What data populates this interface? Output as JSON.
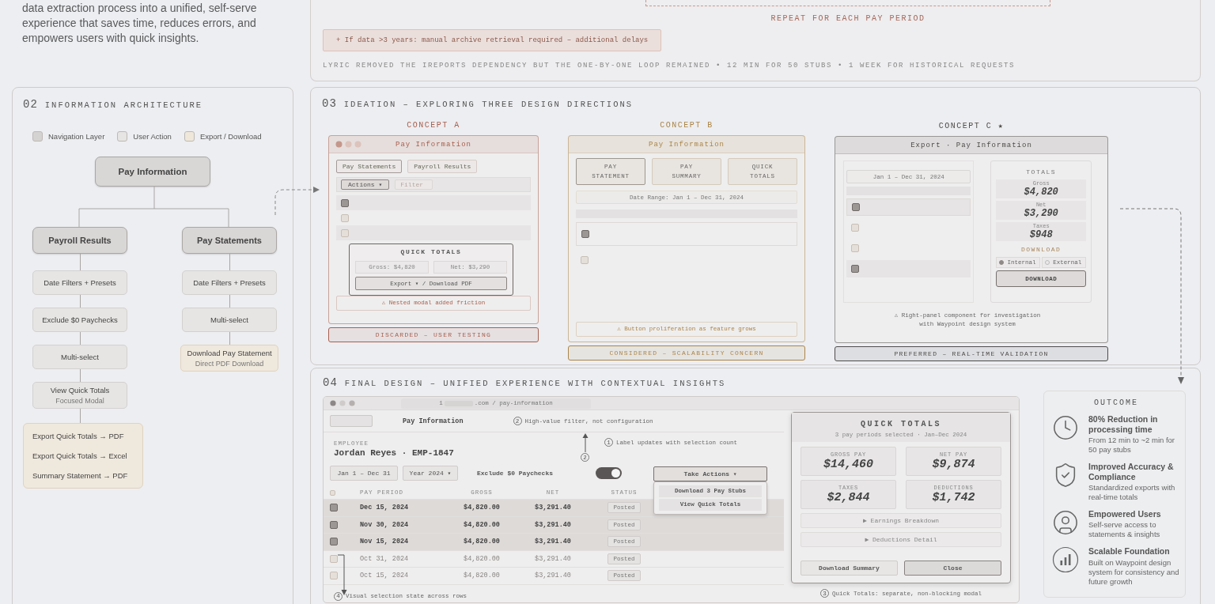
{
  "intro": "data extraction process into a unified, self-serve experience that saves time, reduces errors, and empowers users with quick insights.",
  "process": {
    "loop_label": "REPEAT FOR EACH PAY PERIOD",
    "note": "+ If data >3 years: manual archive retrieval required – additional delays",
    "summary": "LYRIC REMOVED THE IREPORTS DEPENDENCY BUT THE ONE-BY-ONE LOOP REMAINED • 12 MIN FOR 50 STUBS • 1 WEEK FOR HISTORICAL REQUESTS"
  },
  "architecture": {
    "number": "02",
    "title": "INFORMATION ARCHITECTURE",
    "legend": [
      {
        "label": "Navigation Layer",
        "color": "#d5d3d2"
      },
      {
        "label": "User Action",
        "color": "#e6e5e3"
      },
      {
        "label": "Export / Download",
        "color": "#efe7da"
      }
    ],
    "root": "Pay Information",
    "branches": [
      {
        "label": "Payroll Results",
        "steps": [
          {
            "kind": "action",
            "label": "Date Filters + Presets"
          },
          {
            "kind": "action",
            "label": "Exclude $0 Paychecks"
          },
          {
            "kind": "action",
            "label": "Multi-select"
          },
          {
            "kind": "action",
            "label": "View Quick Totals",
            "sublabel": "Focused Modal"
          },
          {
            "kind": "export_group",
            "items": [
              "Export Quick Totals → PDF",
              "Export Quick Totals → Excel",
              "Summary Statement → PDF"
            ]
          }
        ]
      },
      {
        "label": "Pay Statements",
        "steps": [
          {
            "kind": "action",
            "label": "Date Filters + Presets"
          },
          {
            "kind": "action",
            "label": "Multi-select"
          },
          {
            "kind": "export",
            "label": "Download Pay Statement",
            "sublabel": "Direct PDF Download"
          }
        ]
      }
    ]
  },
  "ideation": {
    "number": "03",
    "title": "IDEATION – EXPLORING THREE DESIGN DIRECTIONS",
    "concepts": [
      {
        "kind": "modal",
        "label": "CONCEPT A",
        "color": "#a8604f",
        "window_title": "Pay Information",
        "tabs": [
          {
            "label": "Pay Statements",
            "selected": true
          },
          {
            "label": "Payroll Results",
            "selected": false
          }
        ],
        "action_button": "Actions ▾",
        "filter_placeholder": "Filter",
        "rows": [
          {
            "checked": true
          },
          {
            "checked": false
          },
          {
            "checked": false
          }
        ],
        "modal": {
          "title": "QUICK TOTALS",
          "stats": [
            "Gross: $4,820",
            "Net: $3,290"
          ],
          "button": "Export ▾ / Download PDF"
        },
        "note": "⚠ Nested modal added friction",
        "status": "DISCARDED – USER TESTING"
      },
      {
        "kind": "buttons",
        "label": "CONCEPT B",
        "color": "#ab8549",
        "window_title": "Pay Information",
        "buttons": [
          {
            "label": "PAY STATEMENT",
            "selected": true
          },
          {
            "label": "PAY SUMMARY",
            "selected": false
          },
          {
            "label": "QUICK TOTALS",
            "selected": false
          }
        ],
        "date_range": "Date Range: Jan 1 – Dec 31, 2024",
        "rows": [
          {
            "checked": true
          },
          {
            "checked": false
          }
        ],
        "note": "⚠ Button proliferation as feature grows",
        "status": "CONSIDERED – SCALABILITY CONCERN"
      },
      {
        "kind": "panel",
        "label": "CONCEPT C ★",
        "color": "#4f4c4a",
        "window_title": "Export · Pay Information",
        "date_range": "Jan 1 – Dec 31, 2024",
        "rows": [
          {
            "checked": true
          },
          {
            "checked": false
          },
          {
            "checked": false
          },
          {
            "checked": true
          }
        ],
        "totals_title": "TOTALS",
        "totals": [
          {
            "label": "Gross",
            "value": "$4,820"
          },
          {
            "label": "Net",
            "value": "$3,290"
          },
          {
            "label": "Taxes",
            "value": "$948"
          }
        ],
        "download_title": "DOWNLOAD",
        "options": [
          {
            "label": "Internal",
            "selected": true
          },
          {
            "label": "External",
            "selected": false
          }
        ],
        "download_button": "DOWNLOAD",
        "note": "⚠ Right-panel component for investigation with Waypoint design system",
        "status": "PREFERRED – REAL-TIME VALIDATION"
      }
    ]
  },
  "final": {
    "number": "04",
    "title": "FINAL DESIGN – UNIFIED EXPERIENCE WITH CONTEXTUAL INSIGHTS",
    "url_start": "1",
    "url_end": ".com / pay-information",
    "app_title": "Pay Information",
    "filter_note": {
      "marker": "2",
      "text": "High-value filter, not configuration"
    },
    "label_note": {
      "marker": "1",
      "text": "Label updates with selection count"
    },
    "arrow_marker": "2",
    "employee_label": "EMPLOYEE",
    "employee": "Jordan Reyes · EMP-1847",
    "filters": [
      "Jan 1 – Dec 31",
      "Year 2024 ▾"
    ],
    "exclude_toggle": {
      "label": "Exclude $0 Paychecks",
      "on": true
    },
    "actions": {
      "label": "Take Actions ▾",
      "expanded": true,
      "items": [
        "Download 3 Pay Stubs",
        "View Quick Totals"
      ]
    },
    "table": {
      "select_all": {
        "checked": false
      },
      "columns": [
        "PAY PERIOD",
        "GROSS",
        "NET",
        "STATUS"
      ],
      "rows": [
        {
          "selected": true,
          "period": "Dec 15, 2024",
          "gross": "$4,820.00",
          "net": "$3,291.40",
          "status": "Posted"
        },
        {
          "selected": true,
          "period": "Nov 30, 2024",
          "gross": "$4,820.00",
          "net": "$3,291.40",
          "status": "Posted"
        },
        {
          "selected": true,
          "period": "Nov 15, 2024",
          "gross": "$4,820.00",
          "net": "$3,291.40",
          "status": "Posted"
        },
        {
          "selected": false,
          "period": "Oct 31, 2024",
          "gross": "$4,820.00",
          "net": "$3,291.40",
          "status": "Posted"
        },
        {
          "selected": false,
          "period": "Oct 15, 2024",
          "gross": "$4,820.00",
          "net": "$3,291.40",
          "status": "Posted"
        }
      ]
    },
    "rows_note": {
      "marker": "4",
      "text": "Visual selection state across rows"
    },
    "quick_totals": {
      "title": "QUICK TOTALS",
      "subtitle": "3 pay periods selected · Jan–Dec 2024",
      "stats": [
        {
          "label": "GROSS PAY",
          "value": "$14,460"
        },
        {
          "label": "NET PAY",
          "value": "$9,874"
        },
        {
          "label": "TAXES",
          "value": "$2,844"
        },
        {
          "label": "DEDUCTIONS",
          "value": "$1,742"
        }
      ],
      "sections": [
        "▶ Earnings Breakdown",
        "▶ Deductions Detail"
      ],
      "buttons": [
        {
          "label": "Download Summary",
          "primary": false
        },
        {
          "label": "Close",
          "primary": true
        }
      ]
    },
    "modal_note": {
      "marker": "3",
      "text": "Quick Totals: separate, non-blocking modal"
    }
  },
  "outcome": {
    "title": "OUTCOME",
    "items": [
      {
        "kind": "clock",
        "title": "80% Reduction in processing time",
        "text": "From 12 min to ~2 min for 50 pay stubs"
      },
      {
        "kind": "shield",
        "title": "Improved Accuracy & Compliance",
        "text": "Standardized exports with real-time totals"
      },
      {
        "kind": "user",
        "title": "Empowered Users",
        "text": "Self-serve access to statements & insights"
      },
      {
        "kind": "chart",
        "title": "Scalable Foundation",
        "text": "Built on Waypoint design system for consistency and future growth"
      }
    ]
  }
}
